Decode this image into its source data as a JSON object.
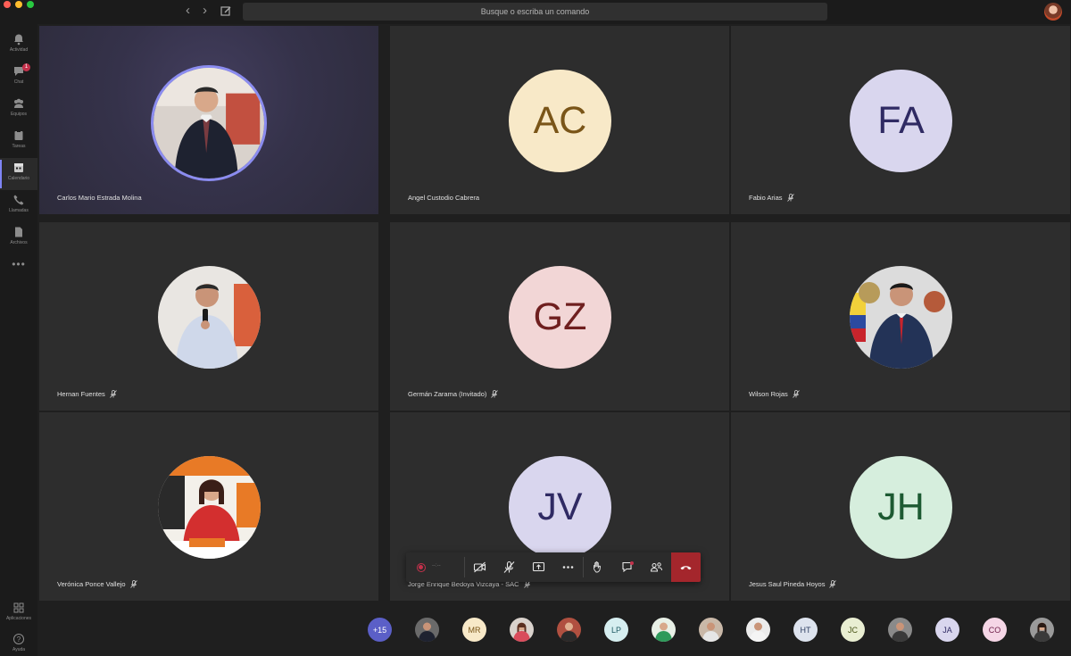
{
  "window": {
    "search_placeholder": "Busque o escriba un comando"
  },
  "rail": {
    "items": [
      {
        "label": "Actividad",
        "icon": "bell-icon"
      },
      {
        "label": "Chat",
        "icon": "chat-icon",
        "badge": "1"
      },
      {
        "label": "Equipos",
        "icon": "teams-icon"
      },
      {
        "label": "Tareas",
        "icon": "tasks-icon"
      },
      {
        "label": "Calendario",
        "icon": "calendar-icon"
      },
      {
        "label": "Llamadas",
        "icon": "phone-icon"
      },
      {
        "label": "Archivos",
        "icon": "files-icon"
      }
    ],
    "more": "•••",
    "apps_label": "Aplicaciones",
    "help_label": "Ayuda"
  },
  "tiles": [
    {
      "name": "Carlos Mario Estrada Molina",
      "initials": "",
      "muted": false,
      "photo": true
    },
    {
      "name": "Angel Custodio Cabrera",
      "initials": "AC",
      "muted": false,
      "bg": "#f8e9c8",
      "fg": "#7a5518"
    },
    {
      "name": "Fabio Arias",
      "initials": "FA",
      "muted": true,
      "bg": "#d9d6ee",
      "fg": "#2f2a63"
    },
    {
      "name": "Hernan Fuentes",
      "initials": "",
      "muted": true,
      "photo": true
    },
    {
      "name": "Germán Zarama (Invitado)",
      "initials": "GZ",
      "muted": true,
      "bg": "#f2d6d6",
      "fg": "#6f1f1f"
    },
    {
      "name": "Wilson Rojas",
      "initials": "",
      "muted": true,
      "photo": true
    },
    {
      "name": "Verónica Ponce Vallejo",
      "initials": "",
      "muted": true,
      "photo": true
    },
    {
      "name": "Jorge Enrique Bedoya Vizcaya - SAC",
      "initials": "JV",
      "muted": true,
      "bg": "#d9d6ee",
      "fg": "#2f2a63"
    },
    {
      "name": "Jesus Saul Pineda Hoyos",
      "initials": "JH",
      "muted": true,
      "bg": "#d6eedd",
      "fg": "#1d5a32"
    }
  ],
  "controls": {
    "timer": "--:--"
  },
  "participants": [
    {
      "label": "+15",
      "bg": "#5b5fc7",
      "fg": "#ffffff"
    },
    {
      "label": "",
      "photo": true
    },
    {
      "label": "MR",
      "bg": "#f8e9c8",
      "fg": "#7a5518"
    },
    {
      "label": "",
      "photo": true
    },
    {
      "label": "",
      "photo": true
    },
    {
      "label": "LP",
      "bg": "#d6eef0",
      "fg": "#1f5a63"
    },
    {
      "label": "",
      "photo": true
    },
    {
      "label": "",
      "photo": true
    },
    {
      "label": "",
      "photo": true
    },
    {
      "label": "HT",
      "bg": "#dde3ee",
      "fg": "#2f3f63"
    },
    {
      "label": "JC",
      "bg": "#e9eed2",
      "fg": "#4a5518"
    },
    {
      "label": "",
      "photo": true
    },
    {
      "label": "JA",
      "bg": "#d9d6ee",
      "fg": "#2f2a63"
    },
    {
      "label": "CO",
      "bg": "#f5d6e6",
      "fg": "#6f1f4a"
    },
    {
      "label": "",
      "photo": true
    }
  ]
}
